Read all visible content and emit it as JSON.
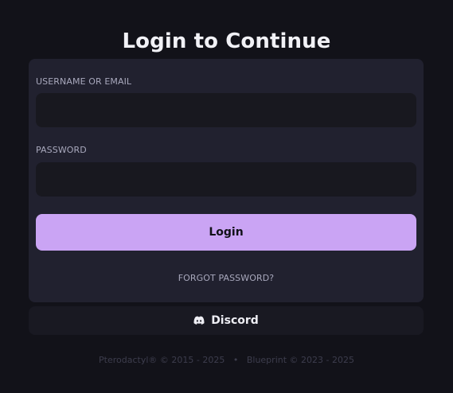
{
  "heading": "Login to Continue",
  "form": {
    "username_label": "USERNAME OR EMAIL",
    "username_value": "",
    "password_label": "PASSWORD",
    "password_value": "",
    "login_label": "Login",
    "forgot_label": "FORGOT PASSWORD?"
  },
  "discord": {
    "label": "Discord",
    "icon": "discord-icon"
  },
  "footer": {
    "pterodactyl": "Pterodactyl® © 2015 - 2025",
    "separator": "•",
    "blueprint": "Blueprint © 2023 - 2025"
  },
  "colors": {
    "background": "#121219",
    "card": "#21212f",
    "input": "#18181f",
    "accent": "#caa4f4",
    "discord_button": "#191922"
  }
}
